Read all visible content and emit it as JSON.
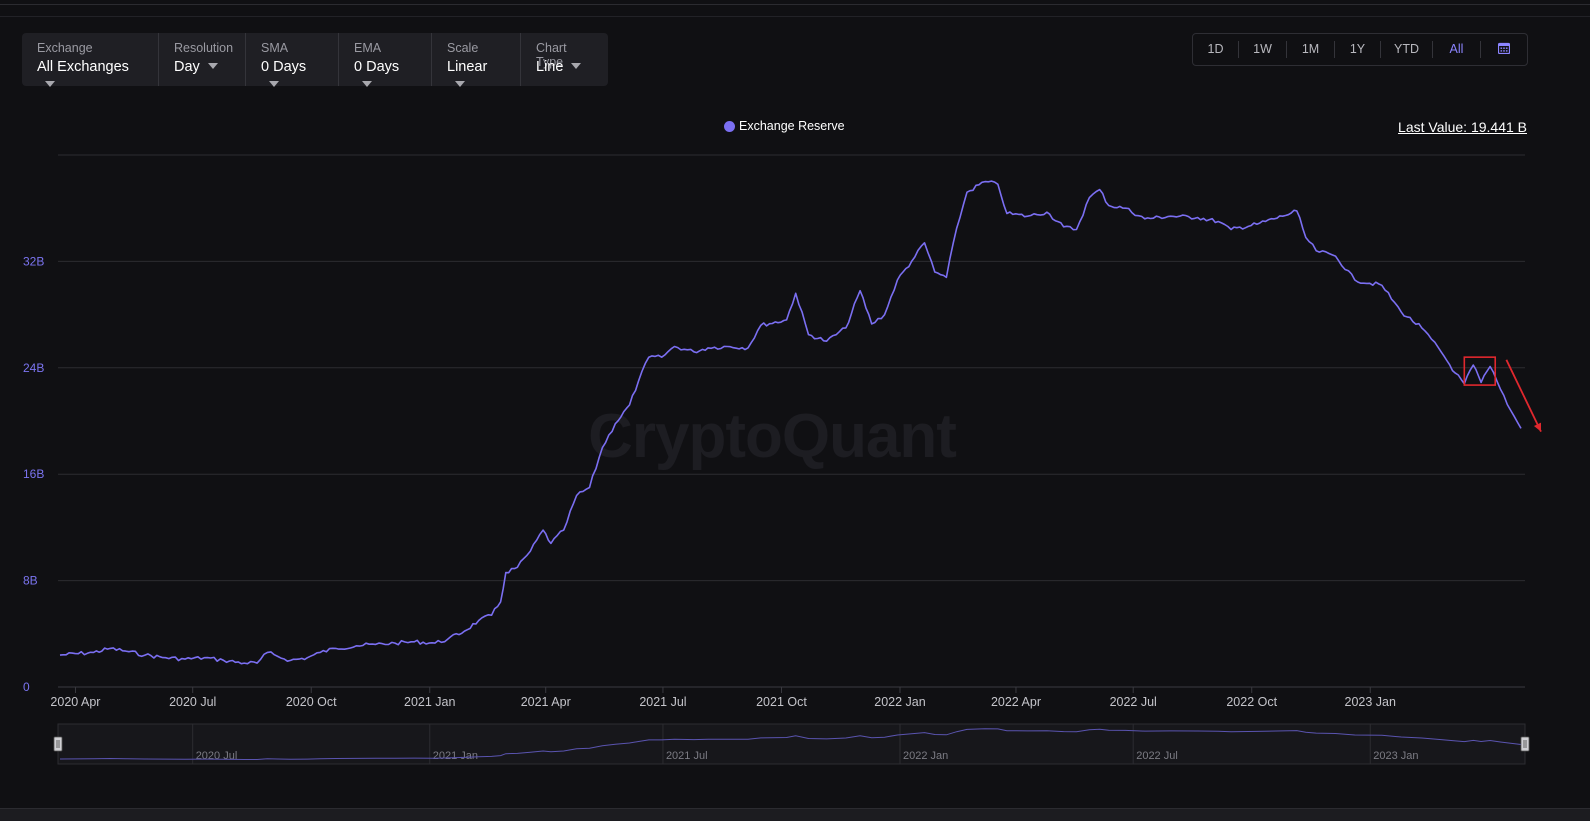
{
  "controls": [
    {
      "label": "Exchange",
      "value": "All Exchanges"
    },
    {
      "label": "Resolution",
      "value": "Day"
    },
    {
      "label": "SMA",
      "value": "0 Days"
    },
    {
      "label": "EMA",
      "value": "0 Days"
    },
    {
      "label": "Scale",
      "value": "Linear"
    },
    {
      "label": "Chart Type",
      "value": "Line"
    }
  ],
  "ranges": {
    "items": [
      "1D",
      "1W",
      "1M",
      "1Y",
      "YTD",
      "All"
    ],
    "active": "All",
    "calendar_icon": "calendar-icon"
  },
  "legend": {
    "label": "Exchange Reserve",
    "color": "#7b6ff2"
  },
  "last_value": "Last Value: 19.441 B",
  "watermark": "CryptoQuant",
  "annotation": {
    "box_color": "#e0282e",
    "arrow_color": "#e0282e"
  },
  "chart_data": {
    "type": "line",
    "x_unit": "date",
    "series": [
      {
        "name": "Exchange Reserve",
        "color": "#7b6ff2",
        "points": [
          [
            "2020-03-20",
            2.4
          ],
          [
            "2020-04-15",
            2.6
          ],
          [
            "2020-04-28",
            2.9
          ],
          [
            "2020-05-10",
            2.7
          ],
          [
            "2020-05-25",
            2.4
          ],
          [
            "2020-06-10",
            2.2
          ],
          [
            "2020-06-25",
            2.1
          ],
          [
            "2020-07-10",
            2.2
          ],
          [
            "2020-07-25",
            2.0
          ],
          [
            "2020-08-10",
            1.8
          ],
          [
            "2020-08-20",
            1.8
          ],
          [
            "2020-08-28",
            2.6
          ],
          [
            "2020-09-05",
            2.3
          ],
          [
            "2020-09-15",
            2.0
          ],
          [
            "2020-09-28",
            2.2
          ],
          [
            "2020-10-08",
            2.6
          ],
          [
            "2020-10-20",
            2.9
          ],
          [
            "2020-11-05",
            3.1
          ],
          [
            "2020-11-20",
            3.2
          ],
          [
            "2020-12-05",
            3.3
          ],
          [
            "2020-12-20",
            3.4
          ],
          [
            "2021-01-05",
            3.3
          ],
          [
            "2021-01-15",
            3.6
          ],
          [
            "2021-01-28",
            4.2
          ],
          [
            "2021-02-08",
            5.0
          ],
          [
            "2021-02-18",
            5.4
          ],
          [
            "2021-02-25",
            6.4
          ],
          [
            "2021-03-01",
            8.6
          ],
          [
            "2021-03-10",
            9.0
          ],
          [
            "2021-03-20",
            10.2
          ],
          [
            "2021-03-30",
            11.8
          ],
          [
            "2021-04-05",
            10.8
          ],
          [
            "2021-04-15",
            11.8
          ],
          [
            "2021-04-25",
            14.4
          ],
          [
            "2021-05-05",
            15.0
          ],
          [
            "2021-05-15",
            18.0
          ],
          [
            "2021-05-25",
            19.8
          ],
          [
            "2021-06-05",
            21.2
          ],
          [
            "2021-06-12",
            23.0
          ],
          [
            "2021-06-20",
            24.8
          ],
          [
            "2021-06-30",
            24.8
          ],
          [
            "2021-07-10",
            25.6
          ],
          [
            "2021-07-25",
            25.2
          ],
          [
            "2021-08-05",
            25.5
          ],
          [
            "2021-08-20",
            25.6
          ],
          [
            "2021-09-05",
            25.5
          ],
          [
            "2021-09-15",
            27.2
          ],
          [
            "2021-10-05",
            27.6
          ],
          [
            "2021-10-12",
            29.6
          ],
          [
            "2021-10-22",
            26.5
          ],
          [
            "2021-11-05",
            26.0
          ],
          [
            "2021-11-20",
            27.0
          ],
          [
            "2021-12-01",
            29.8
          ],
          [
            "2021-12-10",
            27.3
          ],
          [
            "2021-12-20",
            28.0
          ],
          [
            "2021-12-30",
            30.6
          ],
          [
            "2022-01-10",
            32.0
          ],
          [
            "2022-01-20",
            33.4
          ],
          [
            "2022-01-28",
            31.2
          ],
          [
            "2022-02-06",
            30.8
          ],
          [
            "2022-02-14",
            34.5
          ],
          [
            "2022-02-22",
            37.2
          ],
          [
            "2022-03-08",
            38.0
          ],
          [
            "2022-03-18",
            37.8
          ],
          [
            "2022-03-25",
            35.6
          ],
          [
            "2022-04-10",
            35.4
          ],
          [
            "2022-04-25",
            35.7
          ],
          [
            "2022-05-08",
            34.6
          ],
          [
            "2022-05-18",
            34.4
          ],
          [
            "2022-05-28",
            36.8
          ],
          [
            "2022-06-05",
            37.4
          ],
          [
            "2022-06-12",
            36.2
          ],
          [
            "2022-06-25",
            36.0
          ],
          [
            "2022-07-10",
            35.2
          ],
          [
            "2022-07-30",
            35.4
          ],
          [
            "2022-08-20",
            35.3
          ],
          [
            "2022-09-05",
            35.0
          ],
          [
            "2022-09-15",
            34.4
          ],
          [
            "2022-10-05",
            34.8
          ],
          [
            "2022-10-25",
            35.4
          ],
          [
            "2022-11-05",
            35.8
          ],
          [
            "2022-11-12",
            33.8
          ],
          [
            "2022-11-20",
            32.8
          ],
          [
            "2022-12-05",
            32.4
          ],
          [
            "2022-12-20",
            30.6
          ],
          [
            "2023-01-10",
            30.2
          ],
          [
            "2023-01-25",
            28.2
          ],
          [
            "2023-02-10",
            27.0
          ],
          [
            "2023-02-25",
            25.2
          ],
          [
            "2023-03-08",
            23.6
          ],
          [
            "2023-03-15",
            22.8
          ],
          [
            "2023-03-22",
            24.2
          ],
          [
            "2023-03-28",
            22.9
          ],
          [
            "2023-04-04",
            24.1
          ],
          [
            "2023-04-12",
            22.4
          ],
          [
            "2023-04-20",
            20.8
          ],
          [
            "2023-04-28",
            19.441
          ]
        ]
      }
    ],
    "y_ticks": [
      "0",
      "8B",
      "16B",
      "32B",
      "24B"
    ],
    "y_tick_values": [
      0,
      8,
      16,
      32,
      24
    ],
    "y_unit": "B",
    "ylim": [
      0,
      40
    ],
    "x_ticks": [
      {
        "label": "2020 Apr",
        "date": "2020-04-01"
      },
      {
        "label": "2020 Jul",
        "date": "2020-07-01"
      },
      {
        "label": "2020 Oct",
        "date": "2020-10-01"
      },
      {
        "label": "2021 Jan",
        "date": "2021-01-01"
      },
      {
        "label": "2021 Apr",
        "date": "2021-04-01"
      },
      {
        "label": "2021 Jul",
        "date": "2021-07-01"
      },
      {
        "label": "2021 Oct",
        "date": "2021-10-01"
      },
      {
        "label": "2022 Jan",
        "date": "2022-01-01"
      },
      {
        "label": "2022 Apr",
        "date": "2022-04-01"
      },
      {
        "label": "2022 Jul",
        "date": "2022-07-01"
      },
      {
        "label": "2022 Oct",
        "date": "2022-10-01"
      },
      {
        "label": "2023 Jan",
        "date": "2023-01-01"
      }
    ],
    "navigator_ticks": [
      {
        "label": "2020 Jul",
        "date": "2020-07-01"
      },
      {
        "label": "2021 Jan",
        "date": "2021-01-01"
      },
      {
        "label": "2021 Jul",
        "date": "2021-07-01"
      },
      {
        "label": "2022 Jan",
        "date": "2022-01-01"
      },
      {
        "label": "2022 Jul",
        "date": "2022-07-01"
      },
      {
        "label": "2023 Jan",
        "date": "2023-01-01"
      }
    ],
    "grid": true,
    "legend_position": "top-center"
  }
}
